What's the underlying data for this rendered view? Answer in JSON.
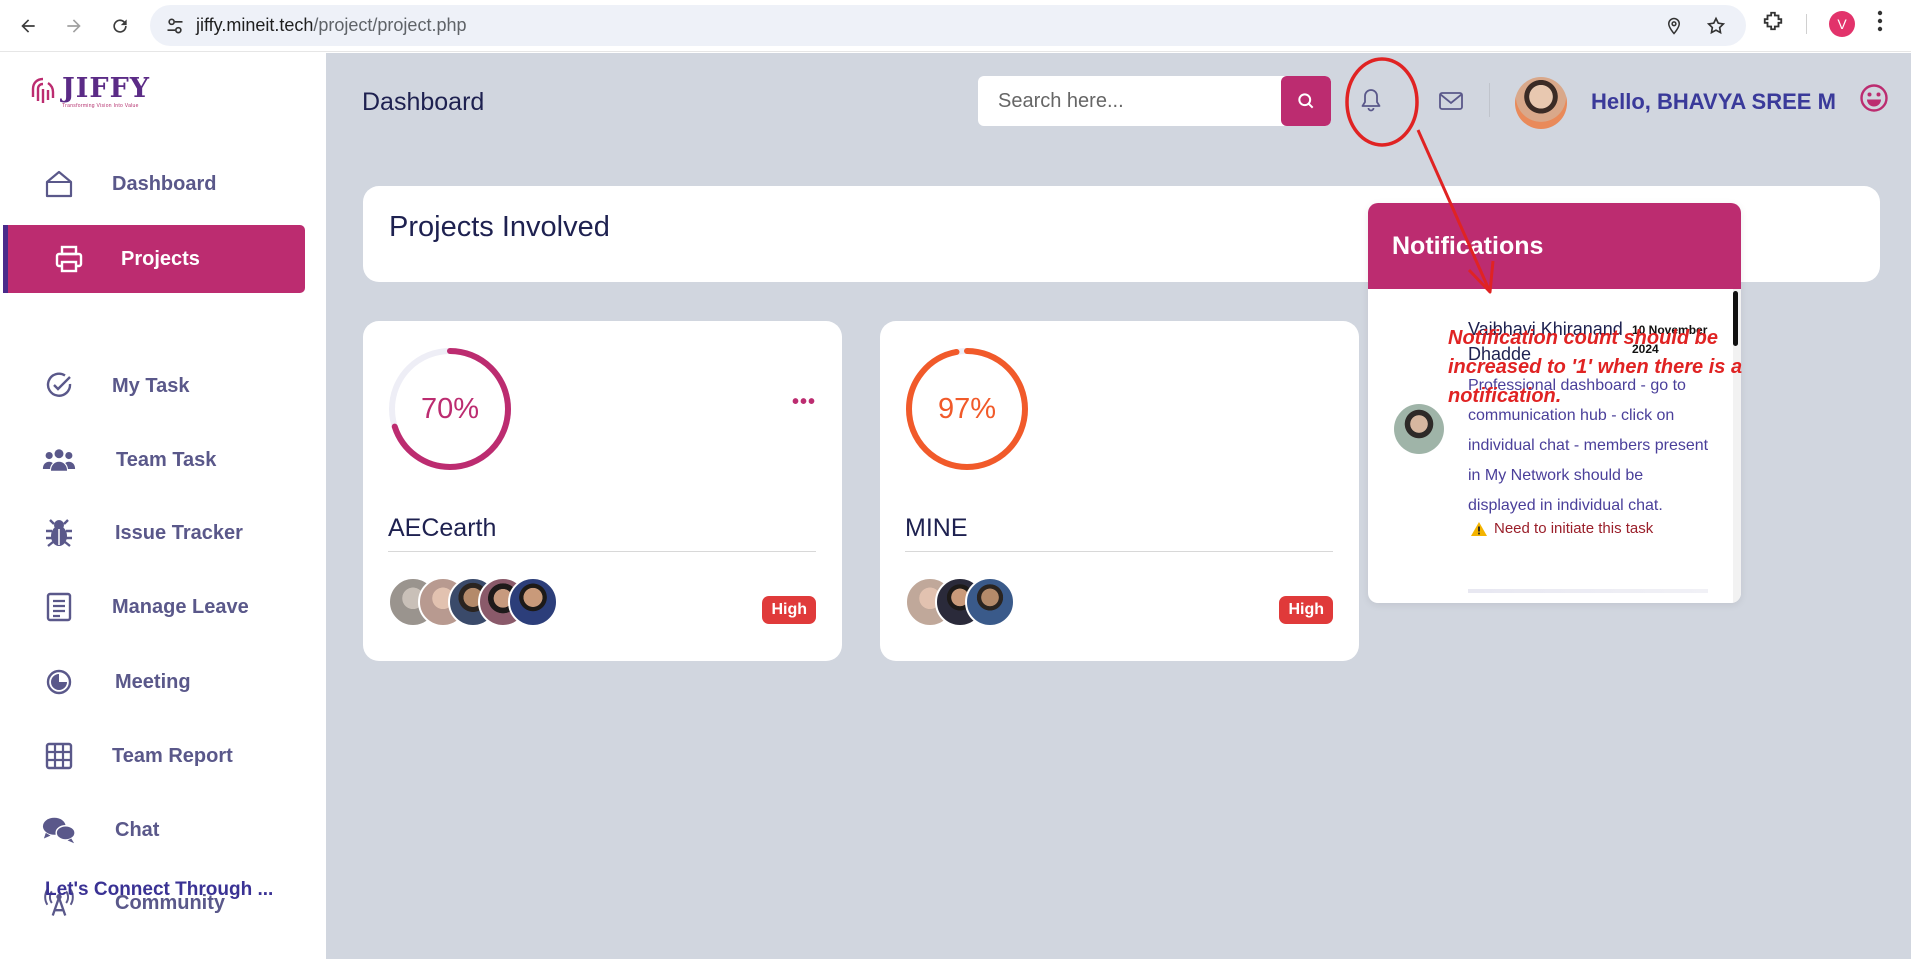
{
  "browser": {
    "url_host": "jiffy.mineit.tech",
    "url_path": "/project/project.php",
    "profile_initial": "V"
  },
  "logo": {
    "title": "JIFFY",
    "tagline": "Transforming Vision Into Value"
  },
  "sidebar": {
    "items": [
      {
        "label": "Dashboard",
        "icon": "home-icon"
      },
      {
        "label": "Projects",
        "icon": "printer-icon",
        "active": true
      },
      {
        "label": "My Task",
        "icon": "check-circle-icon"
      },
      {
        "label": "Team Task",
        "icon": "users-icon"
      },
      {
        "label": "Issue Tracker",
        "icon": "bug-icon"
      },
      {
        "label": "Manage Leave",
        "icon": "document-icon"
      },
      {
        "label": "Meeting",
        "icon": "pie-icon"
      },
      {
        "label": "Team Report",
        "icon": "grid-icon"
      },
      {
        "label": "Chat",
        "icon": "chat-icon"
      },
      {
        "label": "Community",
        "icon": "broadcast-icon"
      }
    ],
    "footer_text": "Let's Connect Through ..."
  },
  "header": {
    "title": "Dashboard",
    "search_placeholder": "Search here...",
    "greeting": "Hello, BHAVYA SREE M"
  },
  "projects_section": {
    "title": "Projects Involved",
    "cards": [
      {
        "name": "AECearth",
        "percent": "70%",
        "progress": 70,
        "color": "#bc2c70",
        "priority": "High",
        "members": 5
      },
      {
        "name": "MINE",
        "percent": "97%",
        "progress": 97,
        "color": "#f15a2a",
        "priority": "High",
        "members": 3
      }
    ]
  },
  "notifications": {
    "title": "Notifications",
    "items": [
      {
        "sender": "Vaibhavi Khiranand Dhadde",
        "date": "10 November 2024",
        "message": "Professional dashboard - go to communication hub - click on individual chat - members present in My Network should be displayed in individual chat.",
        "status": "Need to initiate this task"
      }
    ]
  },
  "annotation": {
    "text": "Notification count should be increased to '1' when there is a notification.",
    "color": "#e02323"
  }
}
